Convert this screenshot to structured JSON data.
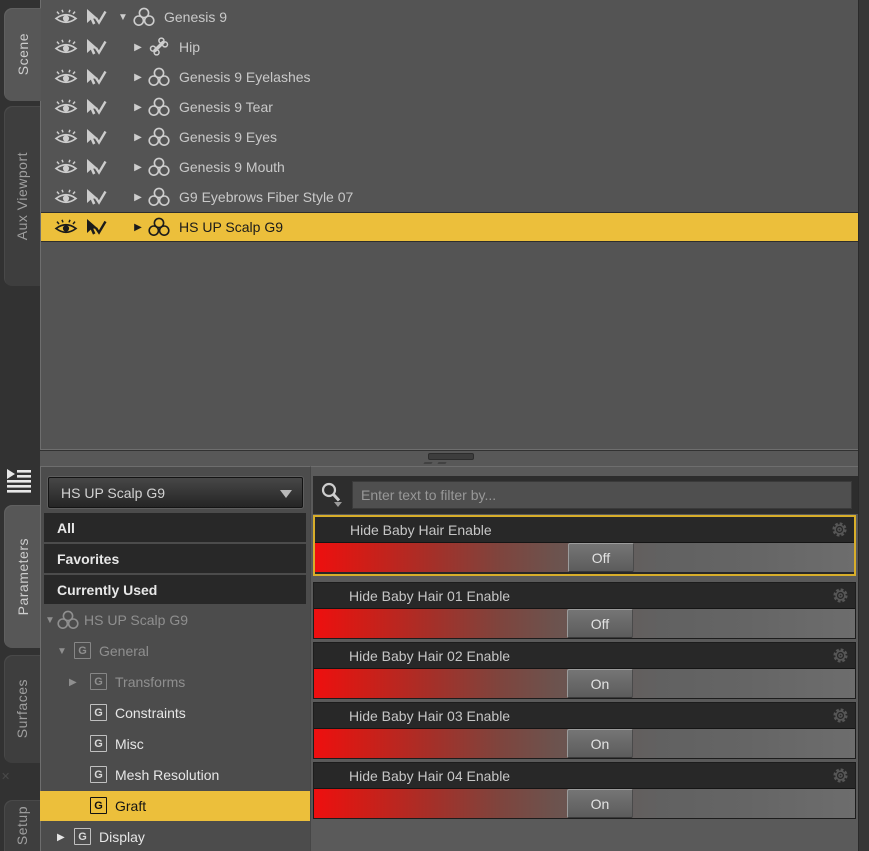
{
  "tabs": {
    "top": [
      {
        "label": "Scene",
        "active": true
      },
      {
        "label": "Aux Viewport",
        "active": false
      }
    ],
    "bottom": [
      {
        "label": "Parameters",
        "active": true
      },
      {
        "label": "Surfaces",
        "active": false
      },
      {
        "label": "Setup",
        "active": false
      }
    ]
  },
  "scene_panel": {
    "rows": [
      {
        "label": "Genesis 9",
        "icon": "figure",
        "arrow": "down",
        "root": true,
        "selected": false
      },
      {
        "label": "Hip",
        "icon": "bone",
        "arrow": "right",
        "root": false,
        "selected": false
      },
      {
        "label": "Genesis 9 Eyelashes",
        "icon": "figure",
        "arrow": "right",
        "root": false,
        "selected": false
      },
      {
        "label": "Genesis 9 Tear",
        "icon": "figure",
        "arrow": "right",
        "root": false,
        "selected": false
      },
      {
        "label": "Genesis 9 Eyes",
        "icon": "figure",
        "arrow": "right",
        "root": false,
        "selected": false
      },
      {
        "label": "Genesis 9 Mouth",
        "icon": "figure",
        "arrow": "right",
        "root": false,
        "selected": false
      },
      {
        "label": "G9 Eyebrows Fiber Style 07",
        "icon": "figure",
        "arrow": "right",
        "root": false,
        "selected": false
      },
      {
        "label": "HS UP Scalp G9",
        "icon": "figure",
        "arrow": "right",
        "root": false,
        "selected": true
      }
    ]
  },
  "parameters_panel": {
    "node_selector_value": "HS UP Scalp G9",
    "filter_placeholder": "Enter text to filter by...",
    "category_rows": [
      {
        "label": "All",
        "kind": "flat"
      },
      {
        "label": "Favorites",
        "kind": "flat"
      },
      {
        "label": "Currently Used",
        "kind": "flat"
      },
      {
        "label": "HS UP Scalp G9",
        "kind": "tree",
        "level": 0,
        "arrow": "down",
        "icon": "figure",
        "dimmed": true,
        "selected": false
      },
      {
        "label": "General",
        "kind": "tree",
        "level": 1,
        "arrow": "down",
        "icon": "G",
        "dimmed": true,
        "selected": false
      },
      {
        "label": "Transforms",
        "kind": "tree",
        "level": 2,
        "arrow": "right",
        "icon": "G",
        "dimmed": true,
        "selected": false
      },
      {
        "label": "Constraints",
        "kind": "tree",
        "level": 2,
        "arrow": "",
        "icon": "G",
        "dimmed": false,
        "selected": false
      },
      {
        "label": "Misc",
        "kind": "tree",
        "level": 2,
        "arrow": "",
        "icon": "G",
        "dimmed": false,
        "selected": false
      },
      {
        "label": "Mesh Resolution",
        "kind": "tree",
        "level": 2,
        "arrow": "",
        "icon": "G",
        "dimmed": false,
        "selected": false
      },
      {
        "label": "Graft",
        "kind": "tree",
        "level": 2,
        "arrow": "",
        "icon": "G",
        "dimmed": false,
        "selected": true
      },
      {
        "label": "Display",
        "kind": "tree",
        "level": 1,
        "arrow": "right",
        "icon": "G",
        "dimmed": false,
        "selected": false
      }
    ],
    "parameters": [
      {
        "label": "Hide Baby Hair Enable",
        "value": "Off",
        "selected": true
      },
      {
        "label": "Hide Baby Hair 01 Enable",
        "value": "Off",
        "selected": false
      },
      {
        "label": "Hide Baby Hair 02 Enable",
        "value": "On",
        "selected": false
      },
      {
        "label": "Hide Baby Hair 03 Enable",
        "value": "On",
        "selected": false
      },
      {
        "label": "Hide Baby Hair 04 Enable",
        "value": "On",
        "selected": false
      }
    ]
  },
  "colors": {
    "selection_yellow": "#ecbf3b",
    "param_selected_border": "#d8ae2a",
    "slider_red": "#ee0f0f"
  }
}
